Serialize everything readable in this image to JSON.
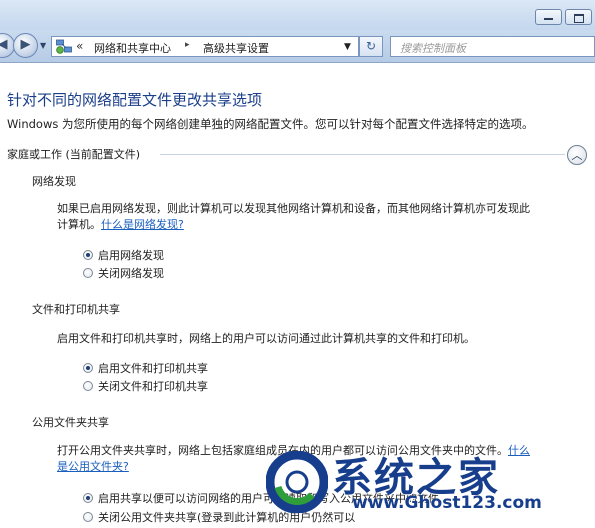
{
  "window": {
    "minimize_label": "",
    "maximize_label": ""
  },
  "nav": {
    "back_glyph": "◀",
    "forward_glyph": "▶",
    "recent_dropdown_glyph": "▼",
    "address_chevron": "«",
    "breadcrumbs": [
      "网络和共享中心",
      "高级共享设置"
    ],
    "breadcrumb_separator": "▸",
    "address_dropdown_glyph": "▼",
    "refresh_glyph": "↻",
    "search_placeholder": "搜索控制面板",
    "address_icon": "network-control-panel-icon"
  },
  "page": {
    "title": "针对不同的网络配置文件更改共享选项",
    "description": "Windows 为您所使用的每个网络创建单独的网络配置文件。您可以针对每个配置文件选择特定的选项。"
  },
  "profile": {
    "header": "家庭或工作 (当前配置文件)",
    "collapse_glyph": "︿"
  },
  "sections": {
    "network_discovery": {
      "heading": "网络发现",
      "desc_line1": "如果已启用网络发现，则此计算机可以发现其他网络计算机和设备，而其他网络计算机亦可发现此",
      "desc_line2_prefix": "计算机。",
      "desc_link": "什么是网络发现?",
      "options": [
        {
          "label": "启用网络发现",
          "selected": true
        },
        {
          "label": "关闭网络发现",
          "selected": false
        }
      ]
    },
    "file_printer_sharing": {
      "heading": "文件和打印机共享",
      "desc_line1": "启用文件和打印机共享时，网络上的用户可以访问通过此计算机共享的文件和打印机。",
      "options": [
        {
          "label": "启用文件和打印机共享",
          "selected": true
        },
        {
          "label": "关闭文件和打印机共享",
          "selected": false
        }
      ]
    },
    "public_folder_sharing": {
      "heading": "公用文件夹共享",
      "desc_line1": "打开公用文件夹共享时，网络上包括家庭组成员在内的用户都可以访问公用文件夹中的文件。",
      "desc_line1_link": "什么",
      "desc_line2_link": "是公用文件夹?",
      "options": [
        {
          "label": "启用共享以便可以访问网络的用户可以读取和写入公用文件夹中的文件",
          "selected": true
        },
        {
          "label": "关闭公用文件夹共享(登录到此计算机的用户仍然可以",
          "selected": false
        }
      ]
    }
  },
  "watermark": {
    "text": "系统之家",
    "url": "www.Ghost123.com",
    "colors": {
      "primary": "#173e8c",
      "accent": "#2e9e3a"
    }
  },
  "colors": {
    "title_blue": "#1a3e8a",
    "link_blue": "#1a5fbd",
    "chrome_blue": "#c4d7ee"
  }
}
